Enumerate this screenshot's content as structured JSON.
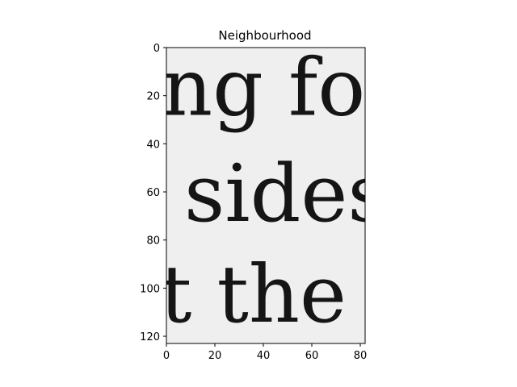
{
  "figure": {
    "title": "Neighbourhood",
    "background": "#ffffff"
  },
  "image_panel": {
    "paper_color": "#efefef",
    "ink_color": "#151515",
    "lines": [
      {
        "text": "ng for",
        "y_data": 28
      },
      {
        "text": "sides",
        "y_data": 72
      },
      {
        "text": "t the",
        "y_data": 114
      }
    ]
  },
  "x_axis": {
    "range": [
      0,
      82
    ],
    "ticks": [
      {
        "value": 0,
        "label": "0"
      },
      {
        "value": 20,
        "label": "20"
      },
      {
        "value": 40,
        "label": "40"
      },
      {
        "value": 60,
        "label": "60"
      },
      {
        "value": 80,
        "label": "80"
      }
    ]
  },
  "y_axis": {
    "range": [
      0,
      123
    ],
    "inverted": true,
    "ticks": [
      {
        "value": 0,
        "label": "0"
      },
      {
        "value": 20,
        "label": "20"
      },
      {
        "value": 40,
        "label": "40"
      },
      {
        "value": 60,
        "label": "60"
      },
      {
        "value": 80,
        "label": "80"
      },
      {
        "value": 100,
        "label": "100"
      },
      {
        "value": 120,
        "label": "120"
      }
    ]
  },
  "colors": {
    "axis": "#000000",
    "frame": "#000000"
  }
}
